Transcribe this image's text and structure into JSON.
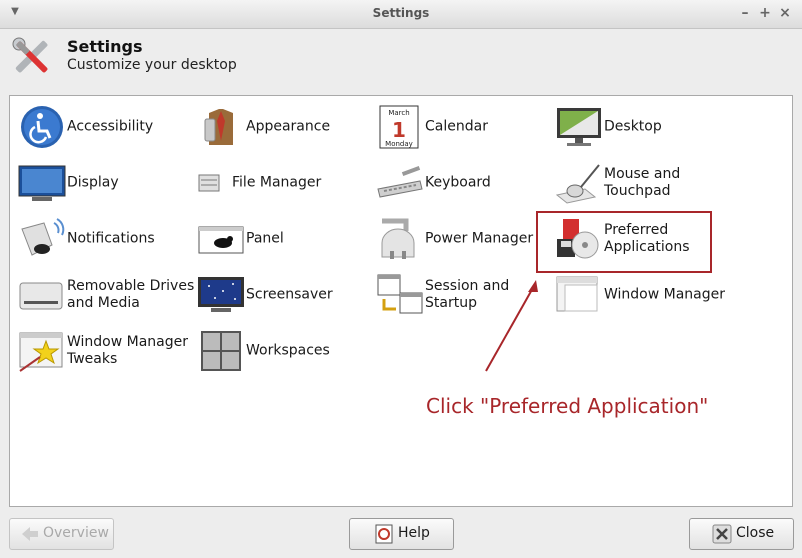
{
  "window": {
    "title": "Settings"
  },
  "header": {
    "title": "Settings",
    "subtitle": "Customize your desktop"
  },
  "items": [
    {
      "label": "Accessibility"
    },
    {
      "label": "Appearance"
    },
    {
      "label": "Calendar"
    },
    {
      "label": "Desktop"
    },
    {
      "label": "Display"
    },
    {
      "label": "File Manager"
    },
    {
      "label": "Keyboard"
    },
    {
      "label": "Mouse and Touchpad"
    },
    {
      "label": "Notifications"
    },
    {
      "label": "Panel"
    },
    {
      "label": "Power Manager"
    },
    {
      "label": "Preferred Applications"
    },
    {
      "label": "Removable Drives and Media"
    },
    {
      "label": "Screensaver"
    },
    {
      "label": "Session and Startup"
    },
    {
      "label": "Window Manager"
    },
    {
      "label": "Window Manager Tweaks"
    },
    {
      "label": "Workspaces"
    }
  ],
  "calendar_icon": {
    "month": "March",
    "day": "1",
    "weekday": "Monday"
  },
  "annotation": {
    "text": "Click \"Preferred Application\"",
    "color": "#a8262a"
  },
  "buttons": {
    "overview": "Overview",
    "help": "Help",
    "close": "Close"
  },
  "colors": {
    "panel_bg": "#ffffff",
    "window_bg": "#ededed",
    "highlight": "#a8262a"
  }
}
